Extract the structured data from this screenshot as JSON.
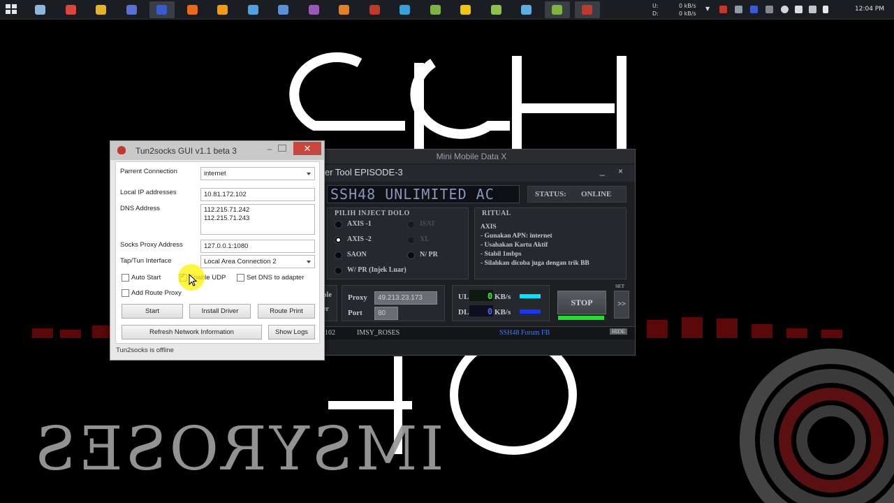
{
  "taskbar": {
    "items": [
      {
        "icon": "file-explorer-icon",
        "color": "#8fb7d8"
      },
      {
        "icon": "tools-app-icon",
        "color": "#d9483b"
      },
      {
        "icon": "chrome-icon",
        "color": "#e6b422"
      },
      {
        "icon": "network-app-icon",
        "color": "#5a6fd6"
      },
      {
        "icon": "u-app-icon",
        "color": "#3a5bd0"
      },
      {
        "icon": "firefox-icon",
        "color": "#e86a1a"
      },
      {
        "icon": "orange-app-icon",
        "color": "#f39c12"
      },
      {
        "icon": "wand-app-icon",
        "color": "#4fa3e0"
      },
      {
        "icon": "globe-app-icon",
        "color": "#5b8fd8"
      },
      {
        "icon": "purple-app-icon",
        "color": "#9b59b6"
      },
      {
        "icon": "orange-square-app-icon",
        "color": "#e67e22"
      },
      {
        "icon": "red-app-icon",
        "color": "#c0392b"
      },
      {
        "icon": "mountain-app-icon",
        "color": "#3aa0d8"
      },
      {
        "icon": "green-shield-app-icon",
        "color": "#7cb342"
      },
      {
        "icon": "yellow-app-icon",
        "color": "#f1c40f"
      },
      {
        "icon": "green-app-icon",
        "color": "#8bc34a"
      },
      {
        "icon": "paint-app-icon",
        "color": "#5dade2"
      },
      {
        "icon": "green-play-app-icon",
        "color": "#7cb342"
      },
      {
        "icon": "tun2socks-app-icon",
        "color": "#c0392b"
      }
    ],
    "net_up_label": "U:",
    "net_down_label": "D:",
    "net_up_value": "0 kB/s",
    "net_down_value": "0 kB/s",
    "clock": "12:04 PM"
  },
  "wallpaper": {
    "ssh_text": "SSH",
    "number_text": "48",
    "brand_text": "IMSYROSES"
  },
  "mini_mobile": {
    "title": "Mini Mobile Data X",
    "subtitle": "er Tool EPISODE-3",
    "minimize": "_",
    "close": "×",
    "lcd_text": "SSH48 UNLIMITED AC",
    "status_label": "STATUS:",
    "status_value": "ONLINE",
    "inject_title": "PILIH INJECT DOLO",
    "options": [
      {
        "label": "AXIS -1",
        "selected": false
      },
      {
        "label": "AXIS -2",
        "selected": true
      },
      {
        "label": "SAON",
        "selected": false
      },
      {
        "label": "W/ PR (Injek Luar)",
        "selected": false
      }
    ],
    "options_right": [
      {
        "label": "ISAT",
        "dim": true
      },
      {
        "label": "XL",
        "dim": true
      },
      {
        "label": "N/ PR",
        "dim": false
      }
    ],
    "ritual_title": "RITUAL",
    "ritual_lines": [
      "AXIS",
      "- Gunakan APN: internet",
      "- Usahakan Kartu Aktif",
      "- Stabil 1mbps",
      "- Silahkan dicoba juga dengan trik BB"
    ],
    "left_partial_top": "ble",
    "left_partial_bottom": "er",
    "proxy_label": "Proxy",
    "proxy_value": "49.213.23.173",
    "port_label": "Port",
    "port_value": "80",
    "ul_label": "UL",
    "dl_label": "DL",
    "ul_value": "0",
    "dl_value": "0",
    "unit": "KB/s",
    "ul_color": "#00e5ff",
    "dl_color": "#1736ff",
    "stop_label": "STOP",
    "stop_bar_color": "#22dd33",
    "set_label": "SET",
    "more_label": ">>",
    "footer_left": "102",
    "footer_name": "IMSY_ROSES",
    "footer_link": "SSH48 Forum FB",
    "hide_label": "HIDE"
  },
  "tun2socks": {
    "title": "Tun2socks GUI v1.1 beta 3",
    "minimize": "–",
    "close": "✕",
    "parent_label": "Parrent Connection",
    "parent_value": "internet",
    "local_ip_label": "Local IP addresses",
    "local_ip_value": "10.81.172.102",
    "dns_label": "DNS Address",
    "dns_line1": "112.215.71.242",
    "dns_line2": "112.215.71.243",
    "socks_label": "Socks Proxy Address",
    "socks_value": "127.0.0.1:1080",
    "tap_label": "Tap/Tun Interface",
    "tap_value": "Local Area Connection 2",
    "auto_start": "Auto Start",
    "enable_udp": "Enable UDP",
    "set_dns": "Set DNS to adapter",
    "add_route": "Add Route Proxy",
    "start": "Start",
    "install_driver": "Install Driver",
    "route_print": "Route Print",
    "refresh": "Refresh Network Information",
    "show_logs": "Show Logs",
    "status": "Tun2socks is offline"
  }
}
